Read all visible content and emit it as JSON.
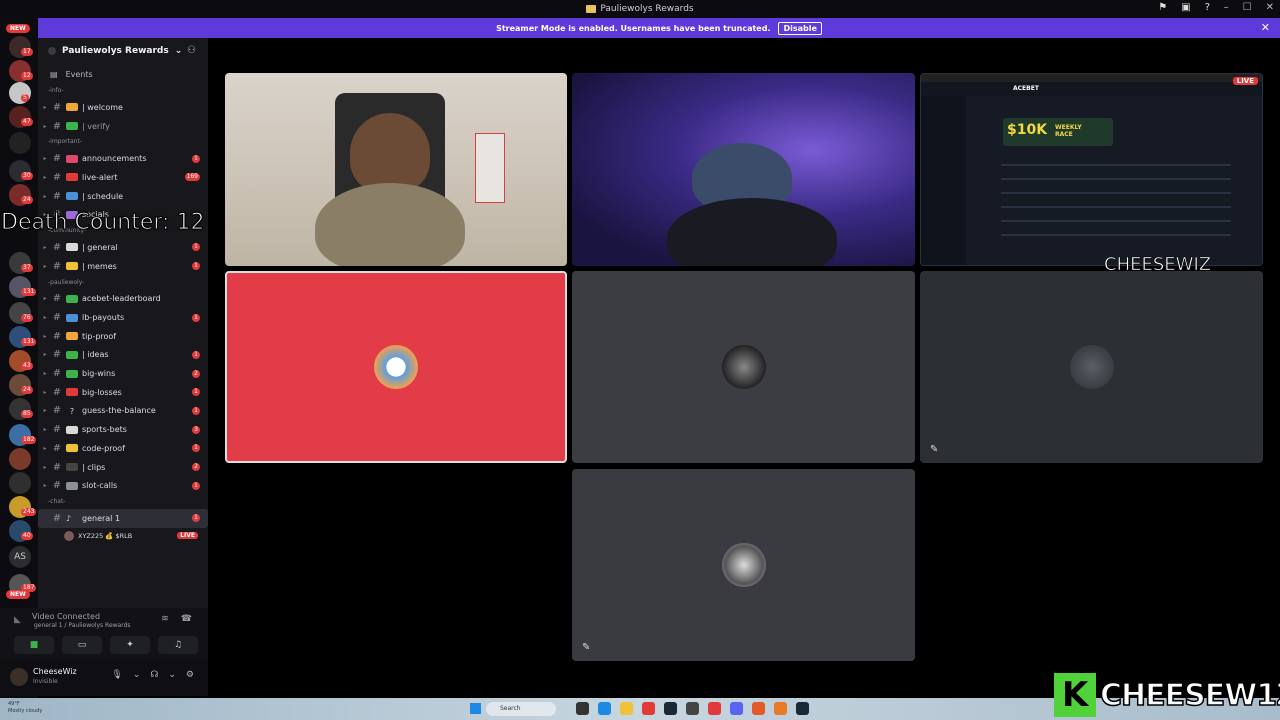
{
  "window": {
    "title": "Pauliewolys Rewards"
  },
  "banner": {
    "message": "Streamer Mode is enabled. Usernames have been truncated.",
    "disable_label": "Disable"
  },
  "rail": {
    "new_top": "NEW",
    "new_bottom": "NEW",
    "as_label": "AS",
    "badges": [
      "17",
      "12",
      "5",
      "47",
      "30",
      "24",
      "169",
      "37",
      "131",
      "76",
      "131",
      "43",
      "24",
      "85",
      "182",
      "243",
      "40",
      "187"
    ]
  },
  "sidebar": {
    "guild_name": "Pauliewolys Rewards",
    "events_label": "Events",
    "categories": {
      "info": "-info-",
      "important": "-important-",
      "community": "-community-",
      "pauliewoly": "-pauliewoly-",
      "chat": "-chat-"
    },
    "channels": [
      {
        "name": "| welcome",
        "count": ""
      },
      {
        "name": "| verify",
        "count": ""
      },
      {
        "name": "announcements",
        "count": "1"
      },
      {
        "name": "live-alert",
        "count": "169"
      },
      {
        "name": "| schedule",
        "count": ""
      },
      {
        "name": "socials",
        "count": ""
      },
      {
        "name": "| general",
        "count": "1"
      },
      {
        "name": "| memes",
        "count": "1"
      },
      {
        "name": "acebet-leaderboard",
        "count": ""
      },
      {
        "name": "lb-payouts",
        "count": "1"
      },
      {
        "name": "tip-proof",
        "count": ""
      },
      {
        "name": "| ideas",
        "count": "1"
      },
      {
        "name": "big-wins",
        "count": "2"
      },
      {
        "name": "big-losses",
        "count": "1"
      },
      {
        "name": "guess-the-balance",
        "count": "1"
      },
      {
        "name": "sports-bets",
        "count": "3"
      },
      {
        "name": "code-proof",
        "count": "1"
      },
      {
        "name": "| clips",
        "count": "2"
      },
      {
        "name": "slot-calls",
        "count": "1"
      }
    ],
    "voice_channel": {
      "name": "general 1",
      "count": "1"
    },
    "voice_user": {
      "name": "XYZ225 💰 $RLB",
      "live": "LIVE"
    }
  },
  "overlay": {
    "death_counter": "Death Counter: 12",
    "tile_label": "CHEESEWIZ",
    "brand_letter": "K",
    "brand_text": "CHEESEW1Z"
  },
  "voice_panel": {
    "status": "Video Connected",
    "sub": "general 1 / Pauliewolys Rewards"
  },
  "user_panel": {
    "name": "CheeseWiz",
    "status": "Invisible"
  },
  "screenshare": {
    "live": "LIVE",
    "logo": "ACEBET",
    "amount": "$10K",
    "promo_line1": "WEEKLY",
    "promo_line2": "RACE"
  },
  "taskbar": {
    "weather_temp": "49°F",
    "weather_desc": "Mostly cloudy",
    "search_placeholder": "Search"
  },
  "colors": {
    "accent": "#5f3adb",
    "badge": "#e23a3a",
    "red_tile": "#e23c48",
    "brand_green": "#52d23a"
  }
}
